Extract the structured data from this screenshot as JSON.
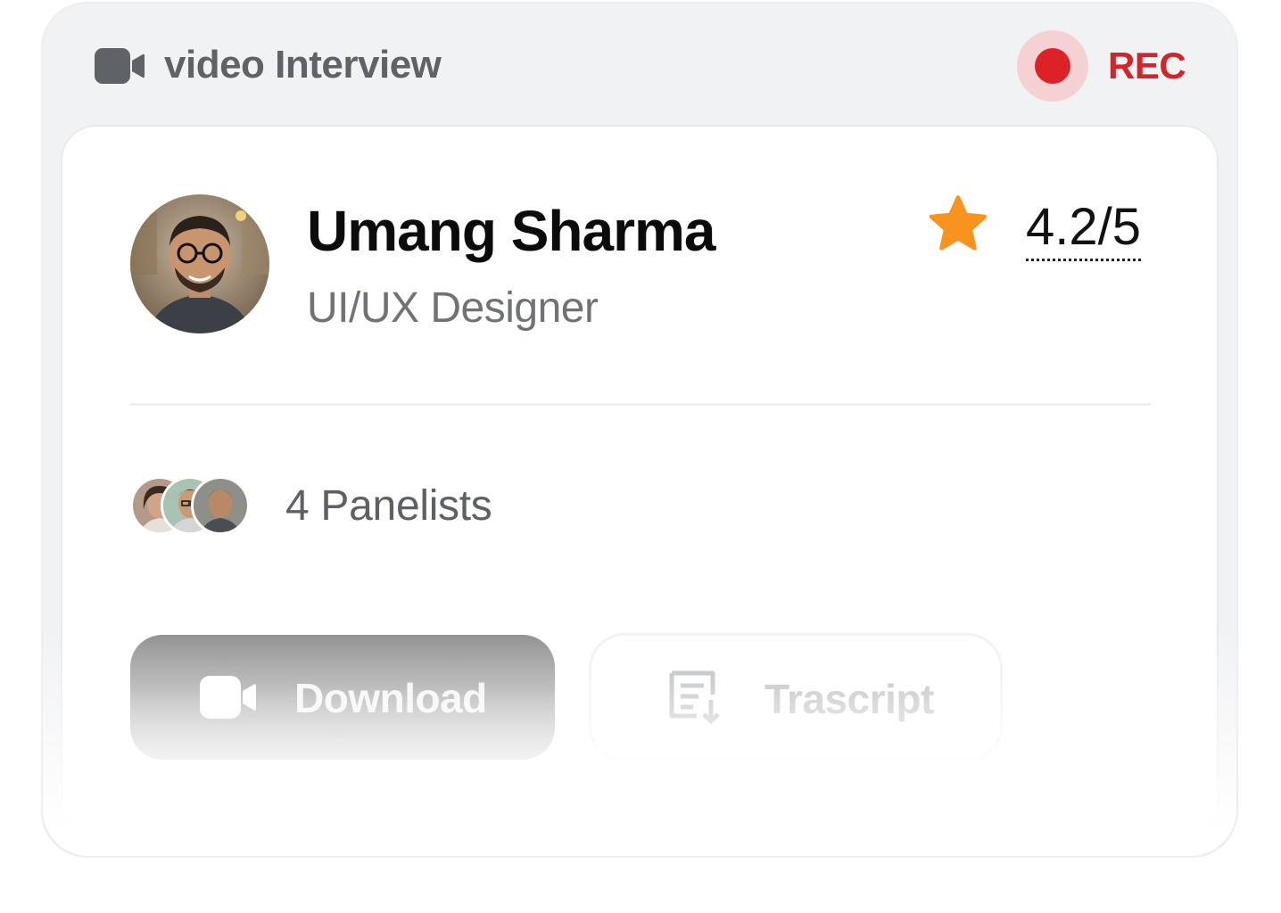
{
  "header": {
    "title": "video Interview",
    "title_icon": "video-camera-icon",
    "recording_label": "REC",
    "recording_color": "#dc2227"
  },
  "candidate": {
    "name": "Umang Sharma",
    "role": "UI/UX Designer",
    "rating": "4.2/5",
    "rating_icon": "star-icon",
    "rating_color": "#f7931e"
  },
  "panel": {
    "label": "4 Panelists",
    "avatar_count_shown": 3
  },
  "actions": {
    "download_label": "Download",
    "download_icon": "video-camera-icon",
    "transcript_label": "Trascript",
    "transcript_icon": "transcript-download-icon"
  }
}
